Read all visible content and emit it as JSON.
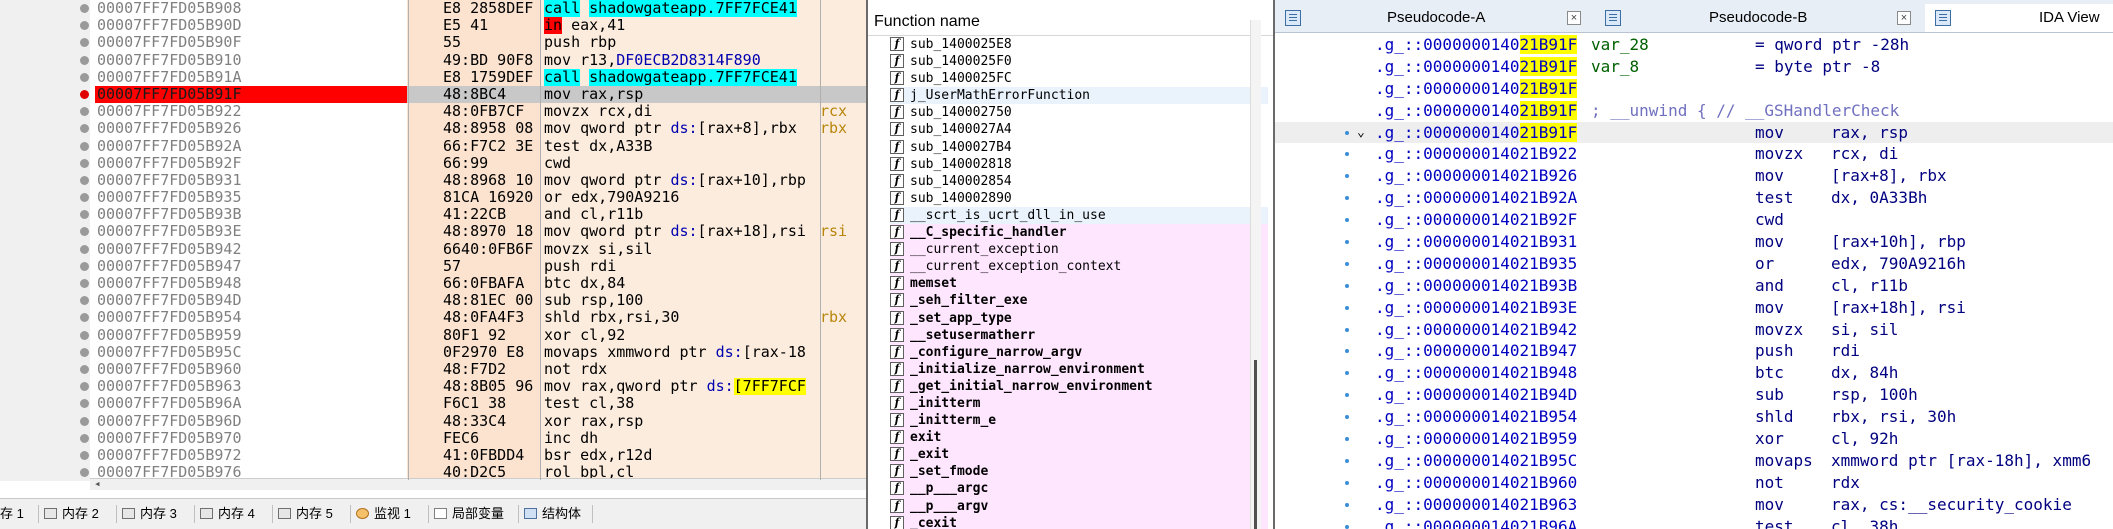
{
  "disasm": {
    "rows": [
      {
        "addr": "00007FF7FD05B908",
        "bytes": "E8 2858DEF",
        "ins": "call",
        "target": "shadowgateapp.7FF7FCE41",
        "type": "call",
        "dot": "normal"
      },
      {
        "addr": "00007FF7FD05B90D",
        "bytes": "E5 41",
        "ins": "in",
        "ops": "eax,41",
        "type": "jcc",
        "dot": "normal"
      },
      {
        "addr": "00007FF7FD05B90F",
        "bytes": "55",
        "ins": "push rbp",
        "type": "plain",
        "dot": "normal"
      },
      {
        "addr": "00007FF7FD05B910",
        "bytes": "49:BD 90F8",
        "ins": "mov r13,",
        "ops": "DF0ECB2D8314F890",
        "type": "plain",
        "dot": "normal"
      },
      {
        "addr": "00007FF7FD05B91A",
        "bytes": "E8 1759DEF",
        "ins": "call",
        "target": "shadowgateapp.7FF7FCE41",
        "type": "call",
        "dot": "normal"
      },
      {
        "addr": "00007FF7FD05B91F",
        "bytes": "48:8BC4",
        "ins": "mov rax,rsp",
        "type": "cur",
        "dot": "bp"
      },
      {
        "addr": "00007FF7FD05B922",
        "bytes": "48:0FB7CF",
        "ins": "movzx rcx,di",
        "side": "rcx",
        "type": "plain",
        "dot": "normal"
      },
      {
        "addr": "00007FF7FD05B926",
        "bytes": "48:8958 08",
        "ins": "mov qword ptr",
        "seg": "ds:",
        "ops": "[rax+8],rbx",
        "side": "rbx",
        "type": "mem",
        "dot": "normal"
      },
      {
        "addr": "00007FF7FD05B92A",
        "bytes": "66:F7C2 3E",
        "ins": "test dx,A33B",
        "type": "plain",
        "dot": "normal"
      },
      {
        "addr": "00007FF7FD05B92F",
        "bytes": "66:99",
        "ins": "cwd",
        "type": "plain",
        "dot": "normal"
      },
      {
        "addr": "00007FF7FD05B931",
        "bytes": "48:8968 10",
        "ins": "mov qword ptr",
        "seg": "ds:",
        "ops": "[rax+10],rbp",
        "type": "mem",
        "dot": "normal"
      },
      {
        "addr": "00007FF7FD05B935",
        "bytes": "81CA 16920",
        "ins": "or edx,790A9216",
        "type": "plain",
        "dot": "normal"
      },
      {
        "addr": "00007FF7FD05B93B",
        "bytes": "41:22CB",
        "ins": "and cl,r11b",
        "type": "plain",
        "dot": "normal"
      },
      {
        "addr": "00007FF7FD05B93E",
        "bytes": "48:8970 18",
        "ins": "mov qword ptr",
        "seg": "ds:",
        "ops": "[rax+18],rsi",
        "side": "rsi",
        "type": "mem",
        "dot": "normal"
      },
      {
        "addr": "00007FF7FD05B942",
        "bytes": "6640:0FB6F",
        "ins": "movzx si,sil",
        "type": "plain",
        "dot": "normal"
      },
      {
        "addr": "00007FF7FD05B947",
        "bytes": "57",
        "ins": "push rdi",
        "type": "plain",
        "dot": "normal"
      },
      {
        "addr": "00007FF7FD05B948",
        "bytes": "66:0FBAFA",
        "ins": "btc dx,84",
        "type": "plain",
        "dot": "normal"
      },
      {
        "addr": "00007FF7FD05B94D",
        "bytes": "48:81EC 00",
        "ins": "sub rsp,100",
        "type": "plain",
        "dot": "normal"
      },
      {
        "addr": "00007FF7FD05B954",
        "bytes": "48:0FA4F3",
        "ins": "shld rbx,rsi,30",
        "side": "rbx",
        "type": "plain",
        "dot": "normal"
      },
      {
        "addr": "00007FF7FD05B959",
        "bytes": "80F1 92",
        "ins": "xor cl,92",
        "type": "plain",
        "dot": "normal"
      },
      {
        "addr": "00007FF7FD05B95C",
        "bytes": "0F2970 E8",
        "ins": "movaps xmmword ptr",
        "seg": "ds:",
        "ops": "[rax-18",
        "type": "mem",
        "dot": "normal"
      },
      {
        "addr": "00007FF7FD05B960",
        "bytes": "48:F7D2",
        "ins": "not rdx",
        "type": "plain",
        "dot": "normal"
      },
      {
        "addr": "00007FF7FD05B963",
        "bytes": "48:8B05 96",
        "ins": "mov rax,qword ptr",
        "seg": "ds:",
        "ops": "[7FF7FCF",
        "type": "memhl",
        "dot": "normal"
      },
      {
        "addr": "00007FF7FD05B96A",
        "bytes": "F6C1 38",
        "ins": "test cl,38",
        "type": "plain",
        "dot": "normal"
      },
      {
        "addr": "00007FF7FD05B96D",
        "bytes": "48:33C4",
        "ins": "xor rax,rsp",
        "type": "plain",
        "dot": "normal"
      },
      {
        "addr": "00007FF7FD05B970",
        "bytes": "FEC6",
        "ins": "inc dh",
        "type": "plain",
        "dot": "normal"
      },
      {
        "addr": "00007FF7FD05B972",
        "bytes": "41:0FBDD4",
        "ins": "bsr edx,r12d",
        "type": "plain",
        "dot": "normal"
      },
      {
        "addr": "00007FF7FD05B976",
        "bytes": "40:D2C5",
        "ins": "rol bpl,cl",
        "type": "plain",
        "dot": "normal"
      }
    ]
  },
  "bottom_tabs": [
    {
      "label": "存 1",
      "icon": "memory-icon",
      "cls": "mem"
    },
    {
      "label": "内存 2",
      "icon": "memory-icon",
      "cls": "mem"
    },
    {
      "label": "内存 3",
      "icon": "memory-icon",
      "cls": "mem"
    },
    {
      "label": "内存 4",
      "icon": "memory-icon",
      "cls": "mem"
    },
    {
      "label": "内存 5",
      "icon": "memory-icon",
      "cls": "mem"
    },
    {
      "label": "监视 1",
      "icon": "watch-icon",
      "cls": "watch"
    },
    {
      "label": "局部变量",
      "icon": "locals-icon",
      "cls": "loc"
    },
    {
      "label": "结构体",
      "icon": "struct-icon",
      "cls": "st"
    }
  ],
  "functions": {
    "header": "Function name",
    "items": [
      {
        "name": "sub_1400025E8",
        "style": "plain"
      },
      {
        "name": "sub_1400025F0",
        "style": "plain"
      },
      {
        "name": "sub_1400025FC",
        "style": "plain"
      },
      {
        "name": "j_UserMathErrorFunction",
        "style": "sel"
      },
      {
        "name": "sub_140002750",
        "style": "plain"
      },
      {
        "name": "sub_1400027A4",
        "style": "plain"
      },
      {
        "name": "sub_1400027B4",
        "style": "plain"
      },
      {
        "name": "sub_140002818",
        "style": "plain"
      },
      {
        "name": "sub_140002854",
        "style": "plain"
      },
      {
        "name": "sub_140002890",
        "style": "plain"
      },
      {
        "name": "__scrt_is_ucrt_dll_in_use",
        "style": "sel"
      },
      {
        "name": "__C_specific_handler",
        "style": "lib-bold"
      },
      {
        "name": "__current_exception",
        "style": "lib"
      },
      {
        "name": "__current_exception_context",
        "style": "lib"
      },
      {
        "name": "memset",
        "style": "lib-bold"
      },
      {
        "name": "_seh_filter_exe",
        "style": "lib-bold"
      },
      {
        "name": "_set_app_type",
        "style": "lib-bold"
      },
      {
        "name": "__setusermatherr",
        "style": "lib-bold"
      },
      {
        "name": "_configure_narrow_argv",
        "style": "lib-bold"
      },
      {
        "name": "_initialize_narrow_environment",
        "style": "lib-bold"
      },
      {
        "name": "_get_initial_narrow_environment",
        "style": "lib-bold"
      },
      {
        "name": "_initterm",
        "style": "lib-bold"
      },
      {
        "name": "_initterm_e",
        "style": "lib-bold"
      },
      {
        "name": "exit",
        "style": "lib-bold"
      },
      {
        "name": "_exit",
        "style": "lib-bold"
      },
      {
        "name": "_set_fmode",
        "style": "lib-bold"
      },
      {
        "name": "__p___argc",
        "style": "lib-bold"
      },
      {
        "name": "__p___argv",
        "style": "lib-bold"
      },
      {
        "name": "_cexit",
        "style": "lib-bold"
      }
    ]
  },
  "ida": {
    "tabs": [
      {
        "title": "Pseudocode-A",
        "close": "×"
      },
      {
        "title": "Pseudocode-B",
        "close": "×"
      },
      {
        "title": "IDA View"
      }
    ],
    "addr_prefix": ".g_::0000000140",
    "rows": [
      {
        "a1": "21B91F",
        "kind": "var",
        "name": "var_28",
        "decl": "= qword ptr -28h"
      },
      {
        "a1": "21B91F",
        "kind": "var",
        "name": "var_8",
        "decl": "= byte ptr -8"
      },
      {
        "a1": "21B91F",
        "kind": "blank"
      },
      {
        "a1": "21B91F",
        "kind": "cmt",
        "text": "; __unwind { // __GSHandlerCheck"
      },
      {
        "a1": "21B91F",
        "kind": "ins",
        "m": "mov",
        "o": "rax, rsp",
        "cur": true,
        "arrow": "⌄",
        "dot": true
      },
      {
        "a2": "21B922",
        "kind": "ins",
        "m": "movzx",
        "o": "rcx, di",
        "dot": true
      },
      {
        "a2": "21B926",
        "kind": "ins",
        "m": "mov",
        "o": "[rax+8], rbx",
        "dot": true
      },
      {
        "a2": "21B92A",
        "kind": "ins",
        "m": "test",
        "o": "dx, 0A33Bh",
        "dot": true
      },
      {
        "a2": "21B92F",
        "kind": "ins",
        "m": "cwd",
        "o": "",
        "dot": true
      },
      {
        "a2": "21B931",
        "kind": "ins",
        "m": "mov",
        "o": "[rax+10h], rbp",
        "dot": true
      },
      {
        "a2": "21B935",
        "kind": "ins",
        "m": "or",
        "o": "edx, 790A9216h",
        "dot": true
      },
      {
        "a2": "21B93B",
        "kind": "ins",
        "m": "and",
        "o": "cl, r11b",
        "dot": true
      },
      {
        "a2": "21B93E",
        "kind": "ins",
        "m": "mov",
        "o": "[rax+18h], rsi",
        "dot": true
      },
      {
        "a2": "21B942",
        "kind": "ins",
        "m": "movzx",
        "o": "si, sil",
        "dot": true
      },
      {
        "a2": "21B947",
        "kind": "ins",
        "m": "push",
        "o": "rdi",
        "dot": true
      },
      {
        "a2": "21B948",
        "kind": "ins",
        "m": "btc",
        "o": "dx, 84h",
        "dot": true
      },
      {
        "a2": "21B94D",
        "kind": "ins",
        "m": "sub",
        "o": "rsp, 100h",
        "dot": true
      },
      {
        "a2": "21B954",
        "kind": "ins",
        "m": "shld",
        "o": "rbx, rsi, 30h",
        "dot": true
      },
      {
        "a2": "21B959",
        "kind": "ins",
        "m": "xor",
        "o": "cl, 92h",
        "dot": true
      },
      {
        "a2": "21B95C",
        "kind": "ins",
        "m": "movaps",
        "o": "xmmword ptr [rax-18h], xmm6",
        "dot": true
      },
      {
        "a2": "21B960",
        "kind": "ins",
        "m": "not",
        "o": "rdx",
        "dot": true
      },
      {
        "a2": "21B963",
        "kind": "ins",
        "m": "mov",
        "o": "rax, cs:__security_cookie",
        "dot": true
      },
      {
        "a2": "21B96A",
        "kind": "ins",
        "m": "test",
        "o": "cl, 38h",
        "dot": true
      }
    ]
  }
}
